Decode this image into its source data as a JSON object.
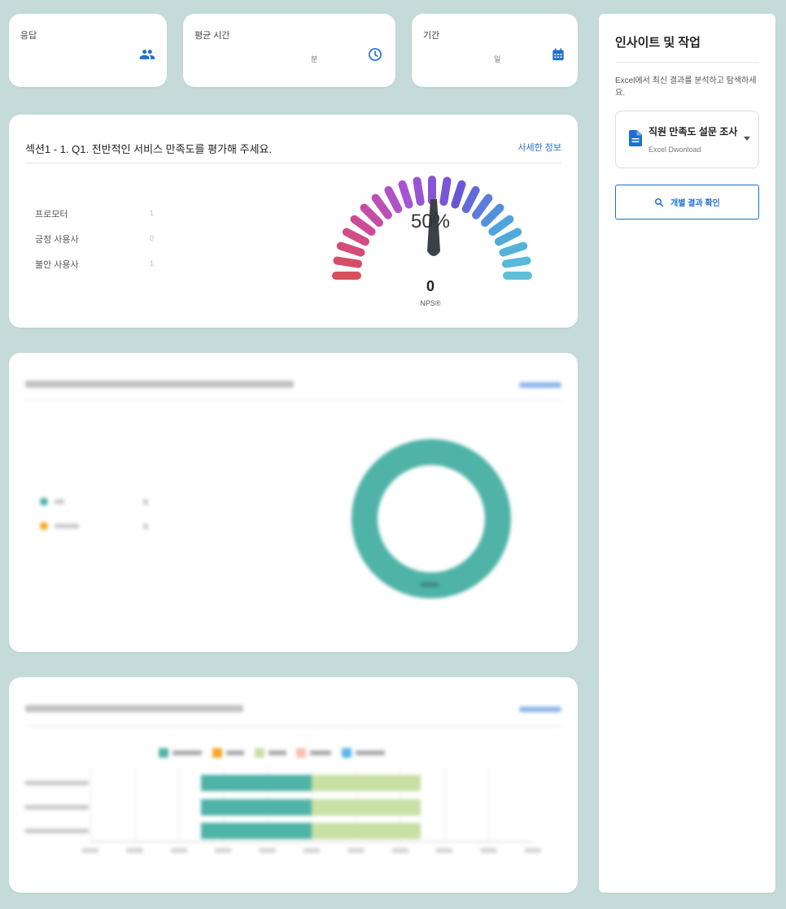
{
  "stats": [
    {
      "label": "응답",
      "unit": "",
      "icon": "people-icon"
    },
    {
      "label": "평균 시간",
      "unit": "분",
      "icon": "clock-icon"
    },
    {
      "label": "기간",
      "unit": "일",
      "icon": "calendar-icon"
    }
  ],
  "nps_card": {
    "title": "섹션1 - 1. Q1. 전반적인 서비스 만족도를 평가해 주세요.",
    "detail_link": "사세한 정보",
    "rows": [
      {
        "label": "프로모터",
        "value": "1"
      },
      {
        "label": "긍정 사용사",
        "value": "0"
      },
      {
        "label": "불안 사용사",
        "value": "1"
      }
    ],
    "gauge_percent": "50%",
    "gauge_fraction": 0.5,
    "nps_value": "0",
    "nps_label": "NPS®"
  },
  "colors": {
    "accent": "#1e6fd1",
    "donut": "#4fb3a7",
    "bar_teal": "#4fb3a7",
    "bar_green": "#c8e0a4",
    "gauge": [
      "#d64f5b",
      "#cf4a96",
      "#a653d4",
      "#6a55d8",
      "#4ba4db",
      "#5cc0d8"
    ]
  },
  "sidebar": {
    "title": "인사이트 및 작업",
    "description": "Excel에서 최신 결과를 분석하고 탐색하세요.",
    "download_title": "직원 만족도 설문 조사",
    "download_subtitle": "Excel Dwonload",
    "results_button": "개별 결과 확인"
  }
}
